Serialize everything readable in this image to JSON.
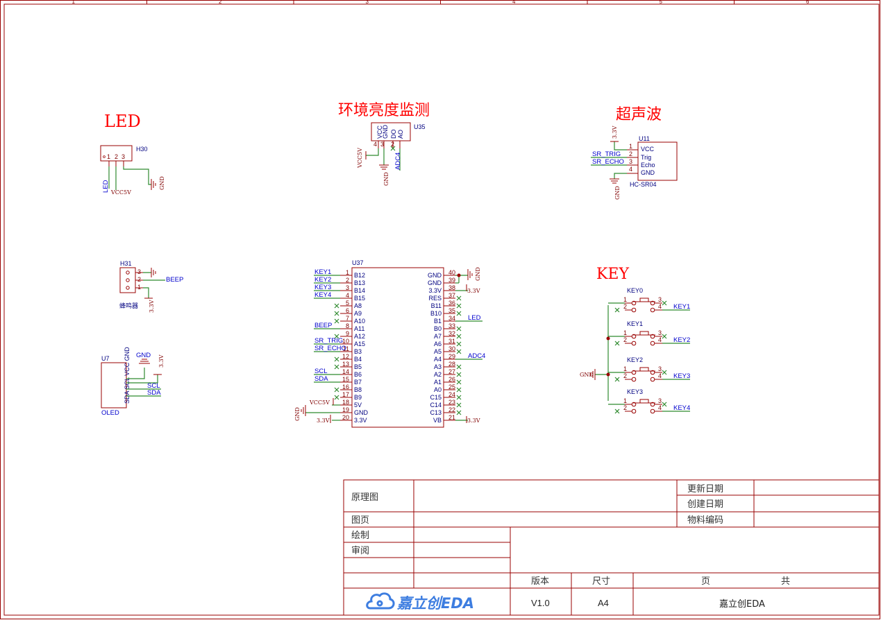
{
  "frame": {
    "border_color": "#990000",
    "wire_color": "#2f8a2f",
    "symbol_color": "#990000",
    "net_color": "#0000cc",
    "title_color": "#ff0000",
    "col_numbers": [
      "1",
      "2",
      "3",
      "4",
      "5",
      "6"
    ]
  },
  "blocks": {
    "led": {
      "title": "LED",
      "ref": "H30",
      "pins": [
        "1",
        "2",
        "3"
      ],
      "nets": [
        "LED",
        "VCC5V",
        "GND"
      ]
    },
    "light": {
      "title": "环境亮度监测",
      "ref": "U35",
      "pin_names": [
        "VCC",
        "GND",
        "DO",
        "AO"
      ],
      "pins": [
        "4",
        "3",
        "2",
        "1"
      ],
      "nets": [
        "VCC5V",
        "GND",
        "ADC4"
      ]
    },
    "ultra": {
      "title": "超声波",
      "ref": "U11",
      "value": "HC-SR04",
      "pin_names": [
        "VCC",
        "Trig",
        "Echo",
        "GND"
      ],
      "pins": [
        "1",
        "2",
        "3",
        "4"
      ],
      "nets": [
        "3.3V",
        "SR_TRIG",
        "SR_ECHO",
        "GND"
      ]
    },
    "buzzer": {
      "ref": "H31",
      "label": "蜂鸣器",
      "pins": [
        "3",
        "2",
        "1"
      ],
      "nets": [
        "BEEP",
        "3.3V"
      ]
    },
    "oled": {
      "ref": "U7",
      "label": "OLED",
      "pin_text": "SDA SCL VCC GND",
      "nets": [
        "GND",
        "3.3V",
        "SCL",
        "SDA"
      ]
    },
    "mcu": {
      "ref": "U37",
      "left": [
        {
          "num": "1",
          "name": "B12",
          "net": "KEY1"
        },
        {
          "num": "2",
          "name": "B13",
          "net": "KEY2"
        },
        {
          "num": "3",
          "name": "B14",
          "net": "KEY3"
        },
        {
          "num": "4",
          "name": "B15",
          "net": "KEY4"
        },
        {
          "num": "5",
          "name": "A8",
          "net": ""
        },
        {
          "num": "6",
          "name": "A9",
          "net": ""
        },
        {
          "num": "7",
          "name": "A10",
          "net": ""
        },
        {
          "num": "8",
          "name": "A11",
          "net": "BEEP"
        },
        {
          "num": "9",
          "name": "A12",
          "net": ""
        },
        {
          "num": "10",
          "name": "A15",
          "net": "SR_TRIG"
        },
        {
          "num": "11",
          "name": "B3",
          "net": "SR_ECHO"
        },
        {
          "num": "12",
          "name": "B4",
          "net": ""
        },
        {
          "num": "13",
          "name": "B5",
          "net": ""
        },
        {
          "num": "14",
          "name": "B6",
          "net": "SCL"
        },
        {
          "num": "15",
          "name": "B7",
          "net": "SDA"
        },
        {
          "num": "16",
          "name": "B8",
          "net": ""
        },
        {
          "num": "17",
          "name": "B9",
          "net": ""
        },
        {
          "num": "18",
          "name": "5V",
          "net": "VCC5V"
        },
        {
          "num": "19",
          "name": "GND",
          "net": "GND"
        },
        {
          "num": "20",
          "name": "3.3V",
          "net": "3.3V"
        }
      ],
      "right": [
        {
          "num": "40",
          "name": "GND",
          "net": "GND"
        },
        {
          "num": "39",
          "name": "GND",
          "net": ""
        },
        {
          "num": "38",
          "name": "3.3V",
          "net": "3.3V"
        },
        {
          "num": "37",
          "name": "RES",
          "net": ""
        },
        {
          "num": "36",
          "name": "B11",
          "net": ""
        },
        {
          "num": "35",
          "name": "B10",
          "net": ""
        },
        {
          "num": "34",
          "name": "B1",
          "net": "LED"
        },
        {
          "num": "33",
          "name": "B0",
          "net": ""
        },
        {
          "num": "32",
          "name": "A7",
          "net": ""
        },
        {
          "num": "31",
          "name": "A6",
          "net": ""
        },
        {
          "num": "30",
          "name": "A5",
          "net": ""
        },
        {
          "num": "29",
          "name": "A4",
          "net": "ADC4"
        },
        {
          "num": "28",
          "name": "A3",
          "net": ""
        },
        {
          "num": "27",
          "name": "A2",
          "net": ""
        },
        {
          "num": "26",
          "name": "A1",
          "net": ""
        },
        {
          "num": "25",
          "name": "A0",
          "net": ""
        },
        {
          "num": "24",
          "name": "C15",
          "net": ""
        },
        {
          "num": "23",
          "name": "C14",
          "net": ""
        },
        {
          "num": "22",
          "name": "C13",
          "net": ""
        },
        {
          "num": "21",
          "name": "VB",
          "net": "3.3V"
        }
      ]
    },
    "keys": {
      "title": "KEY",
      "gnd": "GND",
      "items": [
        {
          "ref": "KEY0",
          "net": "KEY1"
        },
        {
          "ref": "KEY1",
          "net": "KEY2"
        },
        {
          "ref": "KEY2",
          "net": "KEY3"
        },
        {
          "ref": "KEY3",
          "net": "KEY4"
        }
      ],
      "pins": [
        "1",
        "2",
        "3",
        "4"
      ]
    }
  },
  "title_block": {
    "sheet_type": "原理图",
    "page_label": "图页",
    "drawn_label": "绘制",
    "review_label": "审阅",
    "update_date_label": "更新日期",
    "create_date_label": "创建日期",
    "part_code_label": "物料编码",
    "version_label": "版本",
    "size_label": "尺寸",
    "page_no_label": "页",
    "total_label": "共",
    "brand": "嘉立创EDA",
    "version": "V1.0",
    "size": "A4",
    "company": "嘉立创EDA"
  }
}
